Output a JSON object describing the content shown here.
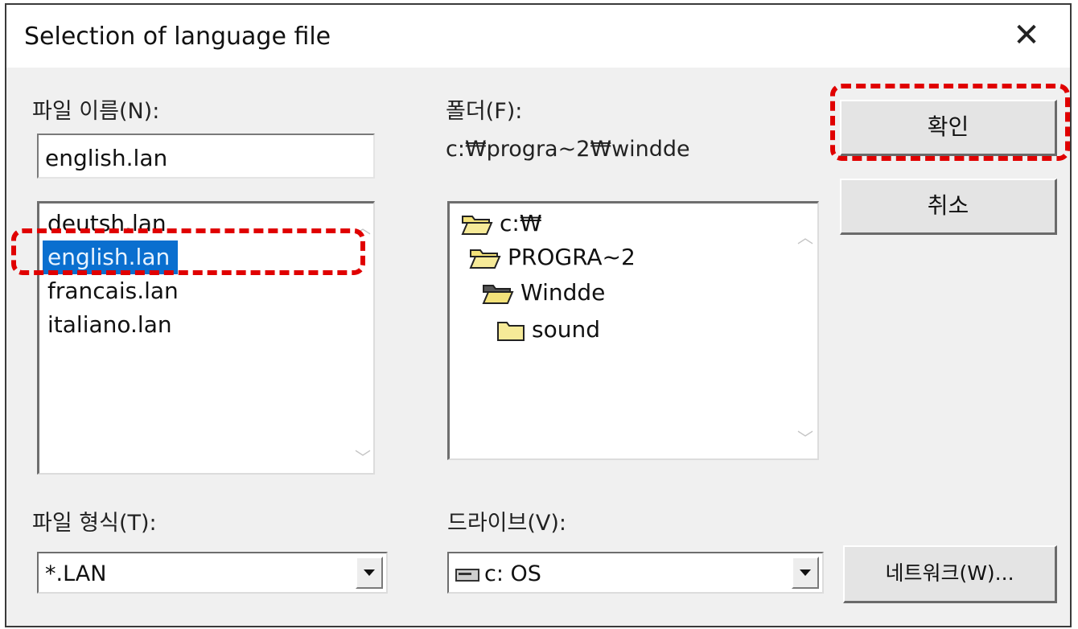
{
  "window": {
    "title": "Selection of language file",
    "close_glyph": "✕"
  },
  "filename": {
    "label": "파일 이름(N):",
    "value": "english.lan",
    "files": [
      "deutsh.lan",
      "english.lan",
      "francais.lan",
      "italiano.lan"
    ],
    "selected": "english.lan"
  },
  "folder": {
    "label": "폴더(F):",
    "path": "c:₩progra~2₩windde",
    "tree": [
      {
        "name": "c:₩",
        "icon": "open-folder-icon"
      },
      {
        "name": "PROGRA~2",
        "icon": "open-folder-icon"
      },
      {
        "name": "Windde",
        "icon": "open-folder-icon"
      },
      {
        "name": "sound",
        "icon": "closed-folder-icon"
      }
    ]
  },
  "filetype": {
    "label": "파일 형식(T):",
    "value": "*.LAN"
  },
  "drive": {
    "label": "드라이브(V):",
    "value": "c: OS",
    "icon": "drive-icon"
  },
  "buttons": {
    "ok": "확인",
    "cancel": "취소",
    "network": "네트워크(W)..."
  },
  "colors": {
    "selection": "#0a6fcf",
    "highlight": "#e00000",
    "folder_fill": "#f3e27a"
  }
}
